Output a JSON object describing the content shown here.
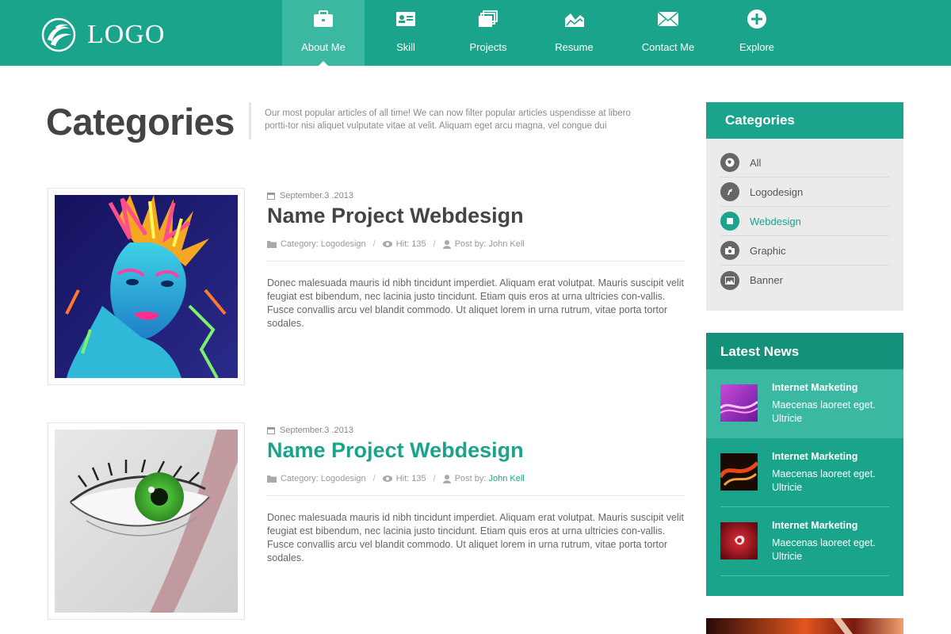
{
  "header": {
    "logo_text": "LOGO",
    "nav": [
      {
        "label": "About Me",
        "icon": "briefcase-icon",
        "active": true
      },
      {
        "label": "Skill",
        "icon": "id-card-icon"
      },
      {
        "label": "Projects",
        "icon": "stacked-pages-icon"
      },
      {
        "label": "Resume",
        "icon": "chart-icon"
      },
      {
        "label": "Contact Me",
        "icon": "envelope-icon"
      },
      {
        "label": "Explore",
        "icon": "plus-circle-icon"
      }
    ]
  },
  "page": {
    "title": "Categories",
    "intro": "Our most popular articles of all time! We can now filter popular articles uspendisse at libero portti-tor nisi aliquet vulputate vitae at velit. Aliquam eget arcu magna, vel congue dui"
  },
  "articles": [
    {
      "date": "September.3 .2013",
      "title": "Name Project Webdesign",
      "category": "Category: Logodesign",
      "hits": "Hit: 135",
      "post_by_label": "Post by:",
      "author": "John Kell",
      "body": "Donec malesuada mauris id nibh tincidunt imperdiet. Aliquam erat volutpat. Mauris suscipit velit feugiat est bibendum, nec lacinia justo tincidunt. Etiam quis eros at urna ultricies con-vallis. Fusce convallis arcu vel blandit commodo. Ut aliquet lorem in urna rutrum, vitae porta tortor sodales."
    },
    {
      "date": "September.3 .2013",
      "title": "Name Project Webdesign",
      "category": "Category: Logodesign",
      "hits": "Hit: 135",
      "post_by_label": "Post by:",
      "author": "John Kell",
      "body": "Donec malesuada mauris id nibh tincidunt imperdiet. Aliquam erat volutpat. Mauris suscipit velit feugiat est bibendum, nec lacinia justo tincidunt. Etiam quis eros at urna ultricies con-vallis. Fusce convallis arcu vel blandit commodo. Ut aliquet lorem in urna rutrum, vitae porta tortor sodales."
    }
  ],
  "sidebar": {
    "categories_title": "Categories",
    "categories": [
      {
        "label": "All",
        "icon": "globe-icon"
      },
      {
        "label": "Logodesign",
        "icon": "pen-icon"
      },
      {
        "label": "Webdesign",
        "icon": "square-icon",
        "active": true
      },
      {
        "label": "Graphic",
        "icon": "camera-icon"
      },
      {
        "label": "Banner",
        "icon": "image-icon"
      }
    ],
    "news_title": "Latest News",
    "news": [
      {
        "title": "Internet Marketing",
        "text": "Maecenas laoreet eget. Ultricie"
      },
      {
        "title": "Internet Marketing",
        "text": "Maecenas laoreet eget. Ultricie"
      },
      {
        "title": "Internet Marketing",
        "text": "Maecenas laoreet eget. Ultricie"
      }
    ]
  },
  "colors": {
    "accent": "#1aa48b",
    "accent_light": "#3bb8a2",
    "accent_dark": "#14917a"
  }
}
